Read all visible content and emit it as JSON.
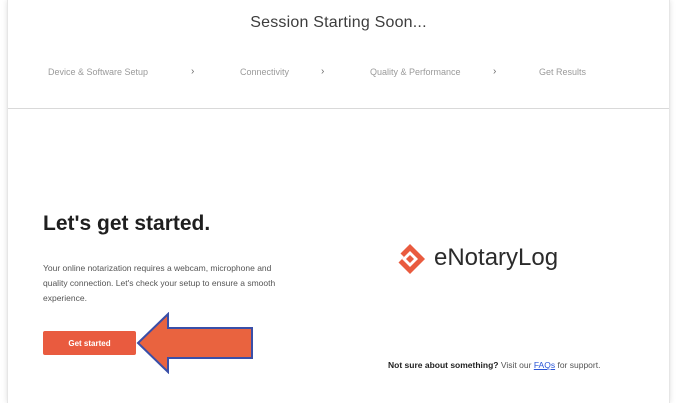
{
  "header": {
    "title": "Session Starting Soon...",
    "steps": [
      {
        "label": "Device & Software Setup"
      },
      {
        "label": "Connectivity"
      },
      {
        "label": "Quality & Performance"
      },
      {
        "label": "Get Results"
      }
    ],
    "separator": "›"
  },
  "main": {
    "heading": "Let's get started.",
    "description": "Your online notarization requires a webcam, microphone and quality connection. Let's check your setup to ensure a smooth experience.",
    "start_button_label": "Get started"
  },
  "brand": {
    "name": "eNotaryLog",
    "logo_icon": "enotarylog-diamond-icon",
    "accent_color": "#e95b3f"
  },
  "support": {
    "question": "Not sure about something?",
    "visit_prefix": "Visit our",
    "link_label": "FAQs",
    "suffix": "for support."
  },
  "annotation": {
    "arrow_icon": "left-arrow-icon",
    "arrow_color": "#e9633f"
  },
  "colors": {
    "link": "#2a55d6",
    "heading": "#1f1f1f",
    "muted": "#9a9a9a"
  }
}
